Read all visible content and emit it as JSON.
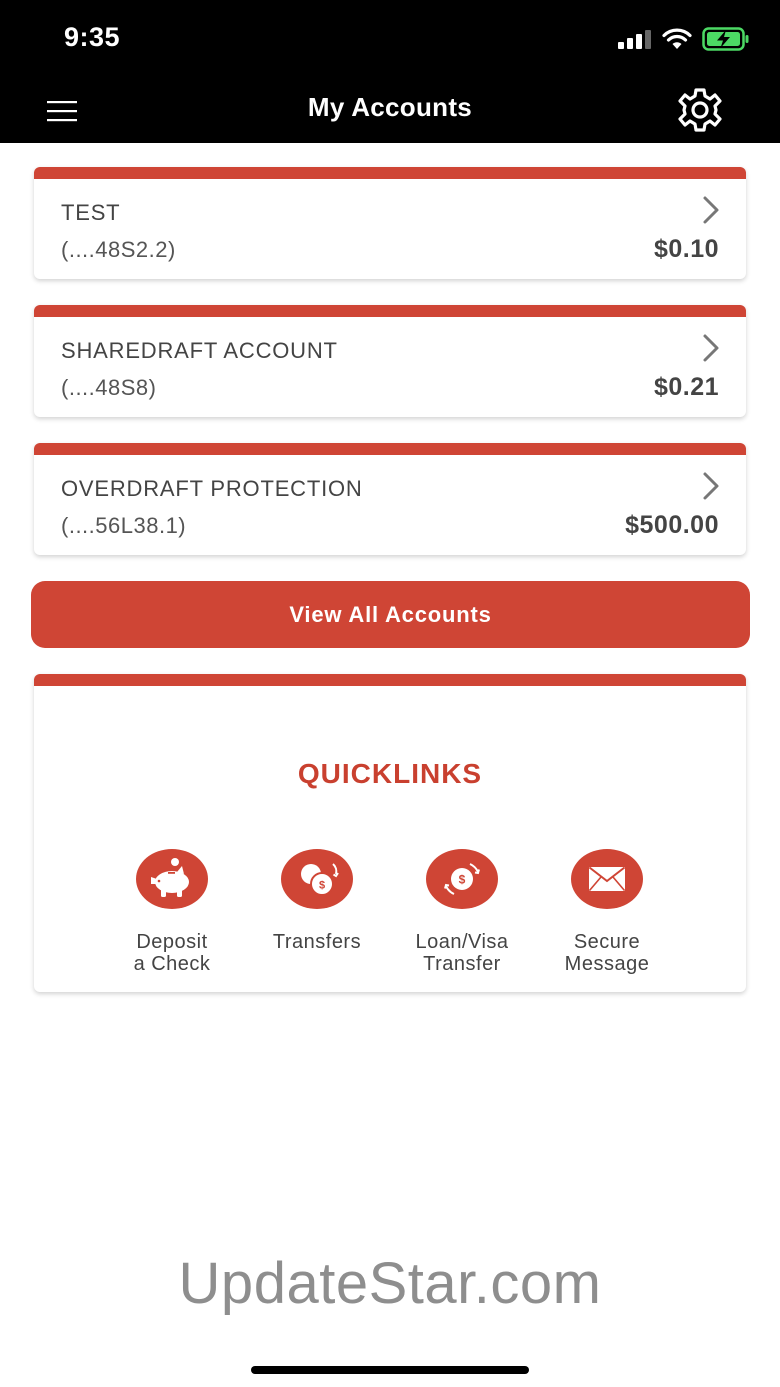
{
  "status_bar": {
    "time": "9:35"
  },
  "header": {
    "title": "My Accounts"
  },
  "accounts": [
    {
      "name": "TEST",
      "number": "(....48S2.2)",
      "balance": "$0.10"
    },
    {
      "name": "SHAREDRAFT ACCOUNT",
      "number": "(....48S8)",
      "balance": "$0.21"
    },
    {
      "name": "OVERDRAFT PROTECTION",
      "number": "(....56L38.1)",
      "balance": "$500.00"
    }
  ],
  "view_all_label": "View All Accounts",
  "quicklinks": {
    "title": "QUICKLINKS",
    "items": [
      {
        "line1": "Deposit",
        "line2": "a Check",
        "icon": "piggy-bank-icon"
      },
      {
        "line1": "Transfers",
        "line2": "",
        "icon": "transfer-coins-icon"
      },
      {
        "line1": "Loan/Visa",
        "line2": "Transfer",
        "icon": "loan-transfer-icon"
      },
      {
        "line1": "Secure",
        "line2": "Message",
        "icon": "envelope-icon"
      }
    ]
  },
  "watermark": "UpdateStar.com",
  "colors": {
    "accent": "#cf4535",
    "header_bg": "#000000",
    "quicklinks_title": "#c9402f"
  }
}
